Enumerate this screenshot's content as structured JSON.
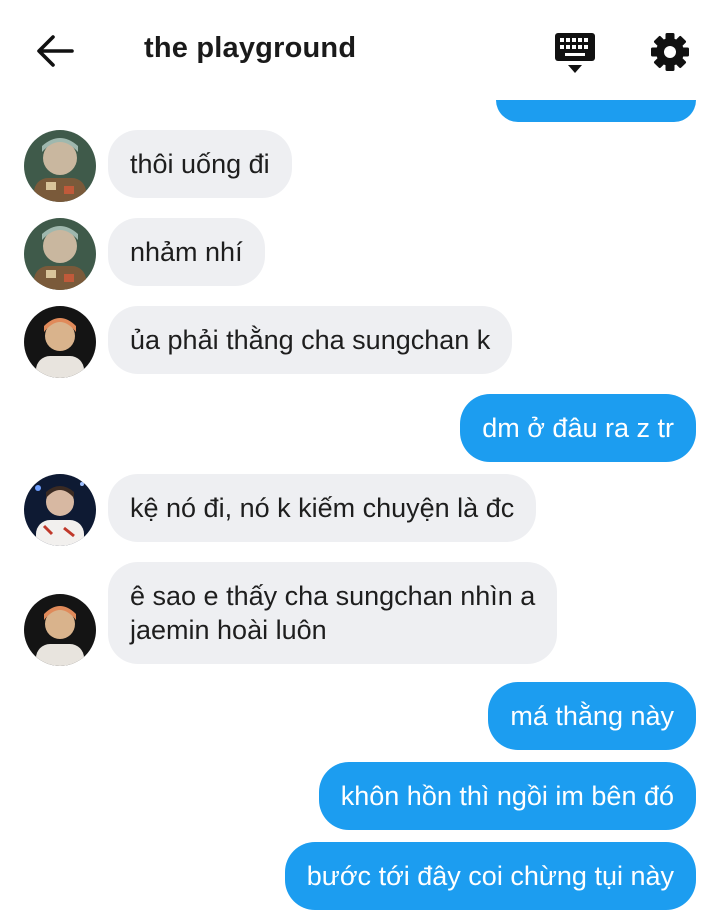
{
  "header": {
    "title": "the playground",
    "icons": {
      "back": "arrow-left-icon",
      "keyboard": "keyboard-icon",
      "settings": "gear-icon"
    }
  },
  "colors": {
    "accent": "#1c9df0",
    "incoming_bubble": "#eeeff2",
    "outgoing_text": "#ffffff"
  },
  "messages": [
    {
      "direction": "in",
      "avatar": "avatar-teal-tinted",
      "lines": [
        "thôi uống đi"
      ]
    },
    {
      "direction": "in",
      "avatar": "avatar-teal-tinted",
      "lines": [
        "nhảm nhí"
      ]
    },
    {
      "direction": "in",
      "avatar": "avatar-dark",
      "lines": [
        "ủa phải thằng cha sungchan k"
      ]
    },
    {
      "direction": "out",
      "lines": [
        "dm ở đâu ra z tr"
      ]
    },
    {
      "direction": "in",
      "avatar": "avatar-blue-stage",
      "lines": [
        "kệ nó đi, nó k kiếm chuyện là đc"
      ]
    },
    {
      "direction": "in",
      "avatar": "avatar-dark",
      "lines": [
        "ê sao e thấy cha sungchan nhìn a",
        "jaemin hoài luôn"
      ]
    },
    {
      "direction": "out",
      "lines": [
        "má thằng này"
      ]
    },
    {
      "direction": "out",
      "lines": [
        "khôn hồn thì ngồi im bên đó"
      ]
    },
    {
      "direction": "out",
      "lines": [
        "bước tới đây coi chừng tụi này"
      ]
    }
  ]
}
